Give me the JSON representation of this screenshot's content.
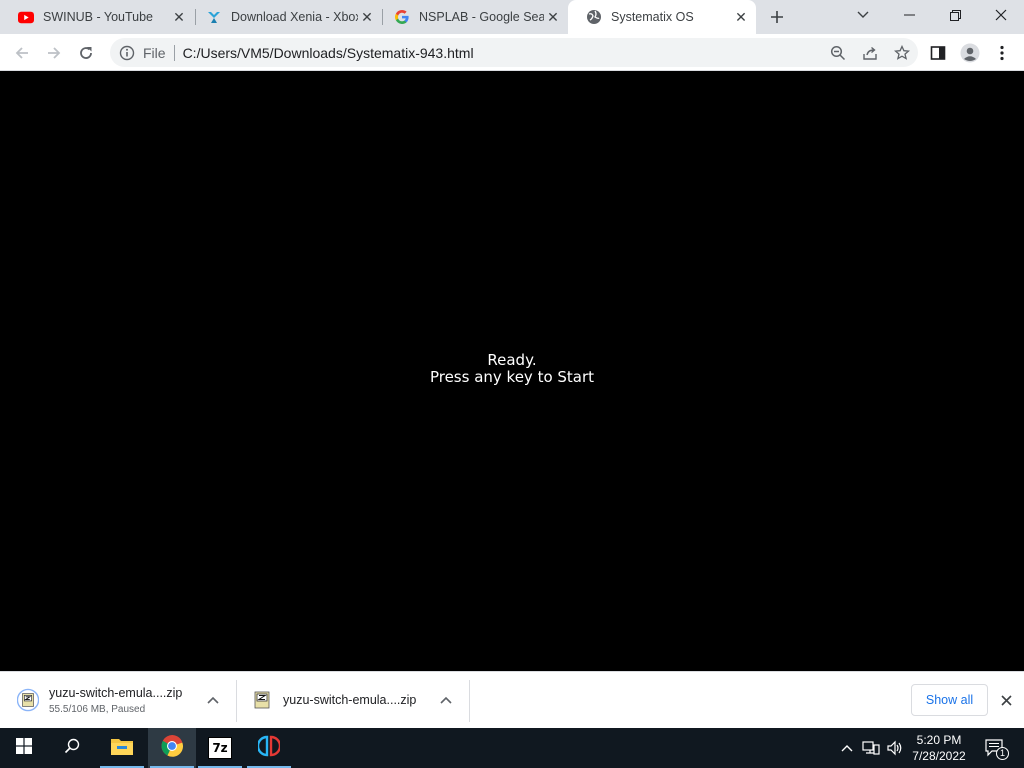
{
  "browser": {
    "tabs": [
      {
        "title": "SWINUB - YouTube",
        "icon": "youtube-icon",
        "active": false
      },
      {
        "title": "Download Xenia - Xbox",
        "icon": "xenia-icon",
        "active": false
      },
      {
        "title": "NSPLAB - Google Search",
        "icon": "google-icon",
        "active": false
      },
      {
        "title": "Systematix OS",
        "icon": "globe-icon",
        "active": true
      }
    ],
    "omnibox": {
      "scheme": "File",
      "url": "C:/Users/VM5/Downloads/Systematix-943.html"
    }
  },
  "page": {
    "line1": "Ready.",
    "line2": "Press any key to Start"
  },
  "downloads": {
    "items": [
      {
        "name": "yuzu-switch-emula....zip",
        "status": "55.5/106 MB, Paused"
      },
      {
        "name": "yuzu-switch-emula....zip",
        "status": ""
      }
    ],
    "show_all_label": "Show all"
  },
  "taskbar": {
    "apps": [
      "start-icon",
      "search-icon",
      "file-explorer-icon",
      "chrome-icon",
      "7zip-icon",
      "yuzu-icon"
    ],
    "seven_zip_label": "7z",
    "time": "5:20 PM",
    "date": "7/28/2022",
    "notification_count": "1"
  },
  "colors": {
    "tabstrip_bg": "#dee1e6",
    "page_bg": "#000000",
    "accent": "#1a73e8",
    "taskbar_bg": "#101820"
  }
}
